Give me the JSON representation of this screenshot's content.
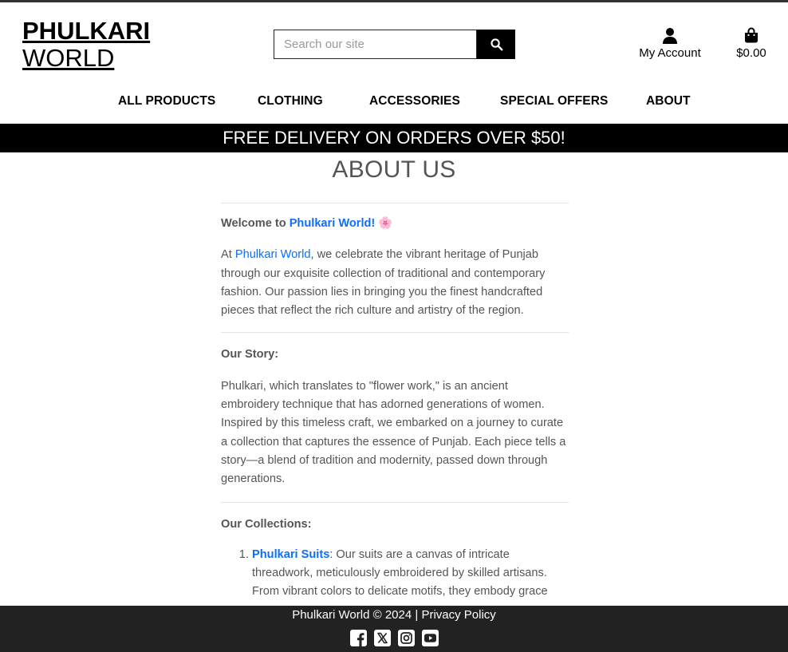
{
  "header": {
    "logo_line1": "PHULKARI",
    "logo_line2": "WORLD",
    "search_placeholder": "Search our site",
    "account_label": "My Account",
    "cart_total": "$0.00"
  },
  "nav": {
    "items": [
      "ALL PRODUCTS",
      "CLOTHING",
      "ACCESSORIES",
      "SPECIAL OFFERS",
      "ABOUT"
    ]
  },
  "banner": "FREE DELIVERY ON ORDERS OVER $50!",
  "main": {
    "title": "ABOUT US",
    "welcome_prefix": "Welcome to ",
    "welcome_link": "Phulkari World!",
    "welcome_emoji": "🌸",
    "intro_prefix": "At ",
    "intro_link": "Phulkari World",
    "intro_rest": ", we celebrate the vibrant heritage of Punjab through our exquisite collection of traditional and contemporary fashion. Our passion lies in bringing you the finest handcrafted pieces that reflect the rich culture and artistry of the region.",
    "story_heading": "Our Story:",
    "story_text": "Phulkari, which translates to \"flower work,\" is an ancient embroidery technique that has adorned generations of women. Inspired by this timeless craft, we embarked on a journey to curate a collection that captures the essence of Punjab. Each piece tells a story—a blend of tradition and modernity, passed down through generations.",
    "collections_heading": "Our Collections:",
    "collections": [
      {
        "name": "Phulkari Suits",
        "description": ": Our suits are a canvas of intricate threadwork, meticulously embroidered by skilled artisans. From vibrant colors to delicate motifs, they embody grace"
      }
    ]
  },
  "footer": {
    "copyright": "Phulkari World © 2024",
    "separator": " | ",
    "privacy": "Privacy Policy",
    "socials": [
      "facebook-icon",
      "x-twitter-icon",
      "instagram-icon",
      "youtube-icon"
    ]
  },
  "colors": {
    "link": "#0d6efd",
    "banner_bg": "#000000",
    "footer_bg": "#222222",
    "text": "#555555"
  }
}
